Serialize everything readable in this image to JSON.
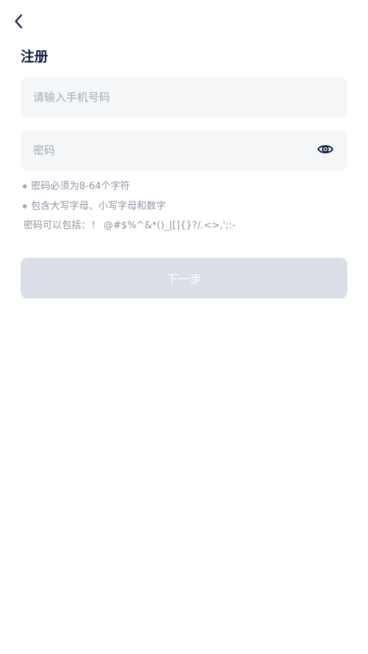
{
  "header": {
    "back_icon": "chevron-left-icon",
    "title": "注册"
  },
  "form": {
    "phone": {
      "value": "",
      "placeholder": "请输入手机号码"
    },
    "password": {
      "value": "",
      "placeholder": "密码",
      "toggle_icon": "eye-icon"
    },
    "rules": {
      "length": "密码必须为8-64个字符",
      "case": "包含大写字母、小写字母和数字",
      "allowed": "密码可以包括：！ @#$%^&*()_|[]{}?/.<>,';:-"
    },
    "next_label": "下一步"
  },
  "colors": {
    "title": "#0f1b3d",
    "field_bg": "#f4f6f8",
    "placeholder": "#a3aab7",
    "hint_text": "#8c93a1",
    "button_disabled_bg": "#d9dee7",
    "button_text": "#ffffff"
  }
}
